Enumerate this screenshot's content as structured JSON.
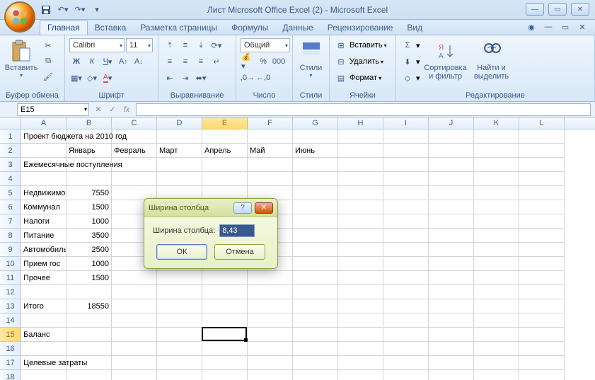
{
  "title": "Лист Microsoft Office Excel (2) - Microsoft Excel",
  "tabs": [
    "Главная",
    "Вставка",
    "Разметка страницы",
    "Формулы",
    "Данные",
    "Рецензирование",
    "Вид"
  ],
  "active_tab": 0,
  "groups": {
    "clipboard": "Буфер обмена",
    "font": "Шрифт",
    "align": "Выравнивание",
    "number": "Число",
    "styles": "Стили",
    "cells": "Ячейки",
    "editing": "Редактирование"
  },
  "ribbon": {
    "paste": "Вставить",
    "font_name": "Calibri",
    "font_size": "11",
    "number_format": "Общий",
    "styles_btn": "Стили",
    "insert": "Вставить",
    "delete": "Удалить",
    "format": "Формат",
    "sort": "Сортировка\nи фильтр",
    "find": "Найти и\nвыделить"
  },
  "namebox": "E15",
  "columns": [
    "A",
    "B",
    "C",
    "D",
    "E",
    "F",
    "G",
    "H",
    "I",
    "J",
    "K",
    "L"
  ],
  "selected_col": 4,
  "selected_row": 15,
  "row_count": 18,
  "cells": {
    "1": {
      "A": "Проект бюджета на 2010 год"
    },
    "2": {
      "B": "Январь",
      "C": "Февраль",
      "D": "Март",
      "E": "Апрель",
      "F": "Май",
      "G": "Июнь"
    },
    "3": {
      "A": "Ежемесячные поступления"
    },
    "5": {
      "A": "Недвижимость",
      "B": "7550"
    },
    "6": {
      "A": "Коммунал",
      "B": "1500"
    },
    "7": {
      "A": "Налоги",
      "B": "1000"
    },
    "8": {
      "A": "Питание",
      "B": "3500"
    },
    "9": {
      "A": "Автомобиль",
      "B": "2500"
    },
    "10": {
      "A": "Прием гос",
      "B": "1000"
    },
    "11": {
      "A": "Прочее",
      "B": "1500"
    },
    "13": {
      "A": "Итого",
      "B": "18550"
    },
    "15": {
      "A": "Баланс"
    },
    "17": {
      "A": "Целевые затраты"
    }
  },
  "dialog": {
    "title": "Ширина столбца",
    "label": "Ширина столбца:",
    "value": "8,43",
    "ok": "ОК",
    "cancel": "Отмена"
  }
}
